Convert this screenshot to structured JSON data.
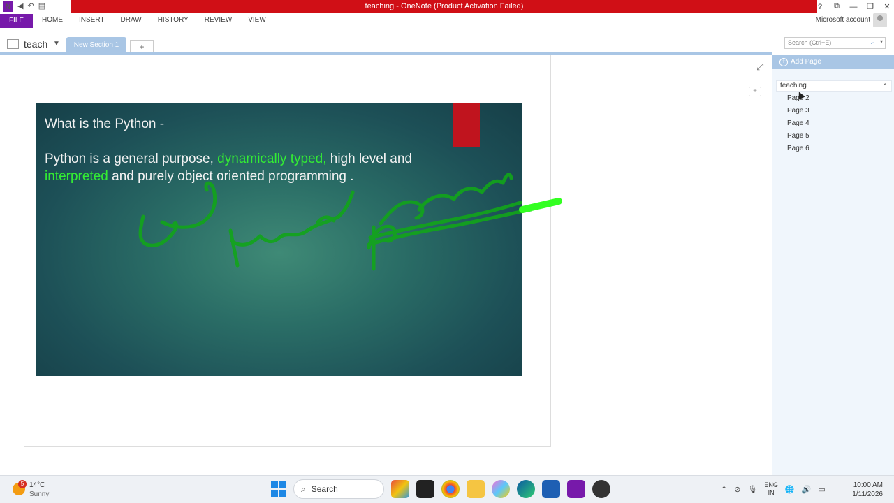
{
  "titlebar": {
    "title": "teaching  -  OneNote (Product Activation Failed)",
    "app_icon": "N",
    "controls": [
      "?",
      "⧉",
      "—",
      "❐",
      "✕"
    ]
  },
  "ribbon": {
    "file": "FILE",
    "tabs": [
      "HOME",
      "INSERT",
      "DRAW",
      "HISTORY",
      "REVIEW",
      "VIEW"
    ],
    "account": "Microsoft account"
  },
  "notebook": {
    "name": "teach",
    "section": "New Section 1",
    "add_section": "+",
    "search_placeholder": "Search (Ctrl+E)"
  },
  "slide": {
    "heading": "What is the Python -",
    "body_pre": " Python is a general  purpose, ",
    "body_hl1": "dynamically typed,",
    "body_mid": " high level and ",
    "body_hl2": "interpreted",
    "body_post": " and purely object  oriented programming .",
    "accent_color": "#33ee33"
  },
  "panel": {
    "add_page": "Add Page",
    "current_page": "teaching",
    "pages": [
      "Page 2",
      "Page 3",
      "Page 4",
      "Page 5",
      "Page 6"
    ]
  },
  "taskbar": {
    "weather_badge": "5",
    "temp": "14°C",
    "condition": "Sunny",
    "search": "Search",
    "lang_top": "ENG",
    "lang_bottom": "IN",
    "time": "10:00 AM",
    "date": "1/11/2026"
  }
}
